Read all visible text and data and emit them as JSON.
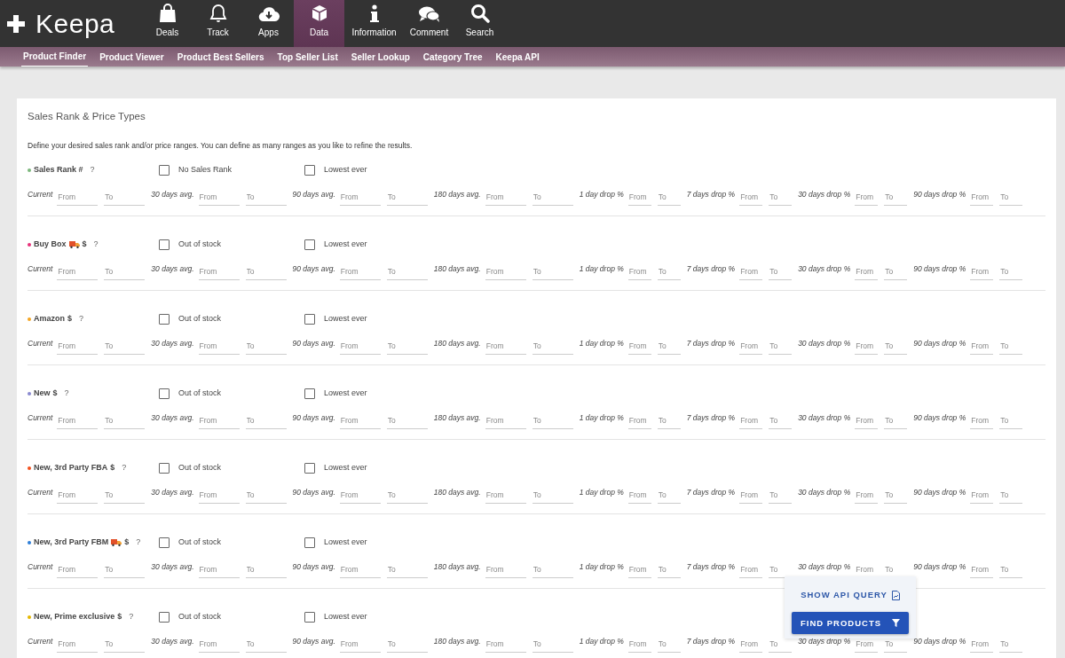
{
  "brand": {
    "name": "Keepa"
  },
  "nav": [
    {
      "label": "Deals",
      "selected": false
    },
    {
      "label": "Track",
      "selected": false
    },
    {
      "label": "Apps",
      "selected": false
    },
    {
      "label": "Data",
      "selected": true
    },
    {
      "label": "Information",
      "selected": false
    },
    {
      "label": "Comment",
      "selected": false
    },
    {
      "label": "Search",
      "selected": false
    }
  ],
  "subnav": [
    {
      "label": "Product Finder",
      "selected": true
    },
    {
      "label": "Product Viewer",
      "selected": false
    },
    {
      "label": "Product Best Sellers",
      "selected": false
    },
    {
      "label": "Top Seller List",
      "selected": false
    },
    {
      "label": "Seller Lookup",
      "selected": false
    },
    {
      "label": "Category Tree",
      "selected": false
    },
    {
      "label": "Keepa API",
      "selected": false
    }
  ],
  "panel": {
    "title": "Sales Rank & Price Types",
    "description": "Define your desired sales rank and/or price ranges. You can define as many ranges as you like to refine the results.",
    "sections": [
      {
        "name": "Sales Rank #",
        "truck": false,
        "color": "#7cb87c",
        "help": "?",
        "options": [
          {
            "label": "No Sales Rank",
            "checked": false
          },
          {
            "label": "Lowest ever",
            "checked": false
          }
        ],
        "ranges": [
          {
            "label": "Current",
            "fields": [
              {
                "placeholder": "From"
              },
              {
                "placeholder": "To"
              }
            ]
          },
          {
            "label": "30 days avg.",
            "fields": [
              {
                "placeholder": "From"
              },
              {
                "placeholder": "To"
              }
            ]
          },
          {
            "label": "90 days avg.",
            "fields": [
              {
                "placeholder": "From"
              },
              {
                "placeholder": "To"
              }
            ]
          },
          {
            "label": "180 days avg.",
            "fields": [
              {
                "placeholder": "From"
              },
              {
                "placeholder": "To"
              }
            ]
          },
          {
            "label": "1 day drop %",
            "fields": [
              {
                "placeholder": "From"
              },
              {
                "placeholder": "To"
              }
            ]
          },
          {
            "label": "7 days drop %",
            "fields": [
              {
                "placeholder": "From"
              },
              {
                "placeholder": "To"
              }
            ]
          },
          {
            "label": "30 days drop %",
            "fields": [
              {
                "placeholder": "From"
              },
              {
                "placeholder": "To"
              }
            ]
          },
          {
            "label": "90 days drop %",
            "fields": [
              {
                "placeholder": "From"
              },
              {
                "placeholder": "To"
              }
            ]
          }
        ]
      },
      {
        "name": "Buy Box",
        "truck": true,
        "unit": "$",
        "color": "#e8317a",
        "help": "?",
        "options": [
          {
            "label": "Out of stock",
            "checked": false
          },
          {
            "label": "Lowest ever",
            "checked": false
          }
        ],
        "ranges": [
          {
            "label": "Current",
            "fields": [
              {
                "placeholder": "From"
              },
              {
                "placeholder": "To"
              }
            ]
          },
          {
            "label": "30 days avg.",
            "fields": [
              {
                "placeholder": "From"
              },
              {
                "placeholder": "To"
              }
            ]
          },
          {
            "label": "90 days avg.",
            "fields": [
              {
                "placeholder": "From"
              },
              {
                "placeholder": "To"
              }
            ]
          },
          {
            "label": "180 days avg.",
            "fields": [
              {
                "placeholder": "From"
              },
              {
                "placeholder": "To"
              }
            ]
          },
          {
            "label": "1 day drop %",
            "fields": [
              {
                "placeholder": "From"
              },
              {
                "placeholder": "To"
              }
            ]
          },
          {
            "label": "7 days drop %",
            "fields": [
              {
                "placeholder": "From"
              },
              {
                "placeholder": "To"
              }
            ]
          },
          {
            "label": "30 days drop %",
            "fields": [
              {
                "placeholder": "From"
              },
              {
                "placeholder": "To"
              }
            ]
          },
          {
            "label": "90 days drop %",
            "fields": [
              {
                "placeholder": "From"
              },
              {
                "placeholder": "To"
              }
            ]
          }
        ]
      },
      {
        "name": "Amazon",
        "truck": false,
        "unit": "$",
        "color": "#f5a623",
        "help": "?",
        "options": [
          {
            "label": "Out of stock",
            "checked": false
          },
          {
            "label": "Lowest ever",
            "checked": false
          }
        ],
        "ranges": [
          {
            "label": "Current",
            "fields": [
              {
                "placeholder": "From"
              },
              {
                "placeholder": "To"
              }
            ]
          },
          {
            "label": "30 days avg.",
            "fields": [
              {
                "placeholder": "From"
              },
              {
                "placeholder": "To"
              }
            ]
          },
          {
            "label": "90 days avg.",
            "fields": [
              {
                "placeholder": "From"
              },
              {
                "placeholder": "To"
              }
            ]
          },
          {
            "label": "180 days avg.",
            "fields": [
              {
                "placeholder": "From"
              },
              {
                "placeholder": "To"
              }
            ]
          },
          {
            "label": "1 day drop %",
            "fields": [
              {
                "placeholder": "From"
              },
              {
                "placeholder": "To"
              }
            ]
          },
          {
            "label": "7 days drop %",
            "fields": [
              {
                "placeholder": "From"
              },
              {
                "placeholder": "To"
              }
            ]
          },
          {
            "label": "30 days drop %",
            "fields": [
              {
                "placeholder": "From"
              },
              {
                "placeholder": "To"
              }
            ]
          },
          {
            "label": "90 days drop %",
            "fields": [
              {
                "placeholder": "From"
              },
              {
                "placeholder": "To"
              }
            ]
          }
        ]
      },
      {
        "name": "New",
        "truck": false,
        "unit": "$",
        "color": "#8a8ad0",
        "help": "?",
        "options": [
          {
            "label": "Out of stock",
            "checked": false
          },
          {
            "label": "Lowest ever",
            "checked": false
          }
        ],
        "ranges": [
          {
            "label": "Current",
            "fields": [
              {
                "placeholder": "From"
              },
              {
                "placeholder": "To"
              }
            ]
          },
          {
            "label": "30 days avg.",
            "fields": [
              {
                "placeholder": "From"
              },
              {
                "placeholder": "To"
              }
            ]
          },
          {
            "label": "90 days avg.",
            "fields": [
              {
                "placeholder": "From"
              },
              {
                "placeholder": "To"
              }
            ]
          },
          {
            "label": "180 days avg.",
            "fields": [
              {
                "placeholder": "From"
              },
              {
                "placeholder": "To"
              }
            ]
          },
          {
            "label": "1 day drop %",
            "fields": [
              {
                "placeholder": "From"
              },
              {
                "placeholder": "To"
              }
            ]
          },
          {
            "label": "7 days drop %",
            "fields": [
              {
                "placeholder": "From"
              },
              {
                "placeholder": "To"
              }
            ]
          },
          {
            "label": "30 days drop %",
            "fields": [
              {
                "placeholder": "From"
              },
              {
                "placeholder": "To"
              }
            ]
          },
          {
            "label": "90 days drop %",
            "fields": [
              {
                "placeholder": "From"
              },
              {
                "placeholder": "To"
              }
            ]
          }
        ]
      },
      {
        "name": "New, 3rd Party FBA",
        "truck": false,
        "unit": "$",
        "color": "#f4511e",
        "help": "?",
        "options": [
          {
            "label": "Out of stock",
            "checked": false
          },
          {
            "label": "Lowest ever",
            "checked": false
          }
        ],
        "ranges": [
          {
            "label": "Current",
            "fields": [
              {
                "placeholder": "From"
              },
              {
                "placeholder": "To"
              }
            ]
          },
          {
            "label": "30 days avg.",
            "fields": [
              {
                "placeholder": "From"
              },
              {
                "placeholder": "To"
              }
            ]
          },
          {
            "label": "90 days avg.",
            "fields": [
              {
                "placeholder": "From"
              },
              {
                "placeholder": "To"
              }
            ]
          },
          {
            "label": "180 days avg.",
            "fields": [
              {
                "placeholder": "From"
              },
              {
                "placeholder": "To"
              }
            ]
          },
          {
            "label": "1 day drop %",
            "fields": [
              {
                "placeholder": "From"
              },
              {
                "placeholder": "To"
              }
            ]
          },
          {
            "label": "7 days drop %",
            "fields": [
              {
                "placeholder": "From"
              },
              {
                "placeholder": "To"
              }
            ]
          },
          {
            "label": "30 days drop %",
            "fields": [
              {
                "placeholder": "From"
              },
              {
                "placeholder": "To"
              }
            ]
          },
          {
            "label": "90 days drop %",
            "fields": [
              {
                "placeholder": "From"
              },
              {
                "placeholder": "To"
              }
            ]
          }
        ]
      },
      {
        "name": "New, 3rd Party FBM",
        "truck": true,
        "unit": "$",
        "color": "#2f7fd8",
        "help": "?",
        "options": [
          {
            "label": "Out of stock",
            "checked": false
          },
          {
            "label": "Lowest ever",
            "checked": false
          }
        ],
        "ranges": [
          {
            "label": "Current",
            "fields": [
              {
                "placeholder": "From"
              },
              {
                "placeholder": "To"
              }
            ]
          },
          {
            "label": "30 days avg.",
            "fields": [
              {
                "placeholder": "From"
              },
              {
                "placeholder": "To"
              }
            ]
          },
          {
            "label": "90 days avg.",
            "fields": [
              {
                "placeholder": "From"
              },
              {
                "placeholder": "To"
              }
            ]
          },
          {
            "label": "180 days avg.",
            "fields": [
              {
                "placeholder": "From"
              },
              {
                "placeholder": "To"
              }
            ]
          },
          {
            "label": "1 day drop %",
            "fields": [
              {
                "placeholder": "From"
              },
              {
                "placeholder": "To"
              }
            ]
          },
          {
            "label": "7 days drop %",
            "fields": [
              {
                "placeholder": "From"
              },
              {
                "placeholder": "To"
              }
            ]
          },
          {
            "label": "30 days drop %",
            "fields": [
              {
                "placeholder": "From"
              },
              {
                "placeholder": "To"
              }
            ]
          },
          {
            "label": "90 days drop %",
            "fields": [
              {
                "placeholder": "From"
              },
              {
                "placeholder": "To"
              }
            ]
          }
        ]
      },
      {
        "name": "New, Prime exclusive",
        "truck": false,
        "unit": "$",
        "color": "#e6b800",
        "help": "?",
        "options": [
          {
            "label": "Out of stock",
            "checked": false
          },
          {
            "label": "Lowest ever",
            "checked": false
          }
        ],
        "ranges": [
          {
            "label": "Current",
            "fields": [
              {
                "placeholder": "From"
              },
              {
                "placeholder": "To"
              }
            ]
          },
          {
            "label": "30 days avg.",
            "fields": [
              {
                "placeholder": "From"
              },
              {
                "placeholder": "To"
              }
            ]
          },
          {
            "label": "90 days avg.",
            "fields": [
              {
                "placeholder": "From"
              },
              {
                "placeholder": "To"
              }
            ]
          },
          {
            "label": "180 days avg.",
            "fields": [
              {
                "placeholder": "From"
              },
              {
                "placeholder": "To"
              }
            ]
          },
          {
            "label": "1 day drop %",
            "fields": [
              {
                "placeholder": "From"
              },
              {
                "placeholder": "To"
              }
            ]
          },
          {
            "label": "7 days drop %",
            "fields": [
              {
                "placeholder": "From"
              },
              {
                "placeholder": "To"
              }
            ]
          },
          {
            "label": "30 days drop %",
            "fields": [
              {
                "placeholder": "From"
              },
              {
                "placeholder": "To"
              }
            ]
          },
          {
            "label": "90 days drop %",
            "fields": [
              {
                "placeholder": "From"
              },
              {
                "placeholder": "To"
              }
            ]
          }
        ]
      }
    ]
  },
  "actions": {
    "api_link": "SHOW API QUERY",
    "find_button": "FIND PRODUCTS"
  }
}
